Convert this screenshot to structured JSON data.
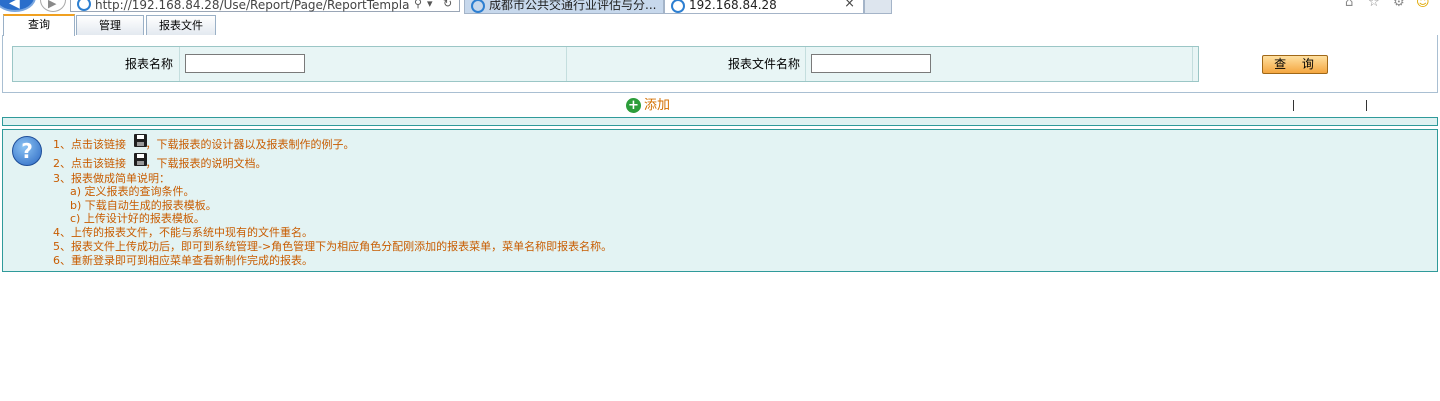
{
  "browser": {
    "address": "http://192.168.84.28/Use/Report/Page/ReportTempla",
    "tabs": [
      {
        "label": "成都市公共交通行业评估与分..."
      },
      {
        "label": "192.168.84.28",
        "close": "×"
      }
    ]
  },
  "page_tabs": [
    {
      "label": "查询"
    },
    {
      "label": "管理"
    },
    {
      "label": "报表文件"
    }
  ],
  "search": {
    "report_name_label": "报表名称",
    "report_name_value": "",
    "report_file_label": "报表文件名称",
    "report_file_value": "",
    "query_button": "查 询"
  },
  "toolbar": {
    "add_label": "添加"
  },
  "help": {
    "lines": [
      {
        "pre": "1、点击该链接 ",
        "post": "，下载报表的设计器以及报表制作的例子。"
      },
      {
        "pre": "2、点击该链接 ",
        "post": "，下载报表的说明文档。"
      },
      {
        "text": "3、报表做成简单说明："
      },
      {
        "text": "a) 定义报表的查询条件。"
      },
      {
        "text": "b) 下载自动生成的报表模板。"
      },
      {
        "text": "c) 上传设计好的报表模板。"
      },
      {
        "text": "4、上传的报表文件，不能与系统中现有的文件重名。"
      },
      {
        "text": "5、报表文件上传成功后，即可到系统管理->角色管理下为相应角色分配刚添加的报表菜单，菜单名称即报表名称。"
      },
      {
        "text": "6、重新登录即可到相应菜单查看新制作完成的报表。"
      }
    ]
  }
}
